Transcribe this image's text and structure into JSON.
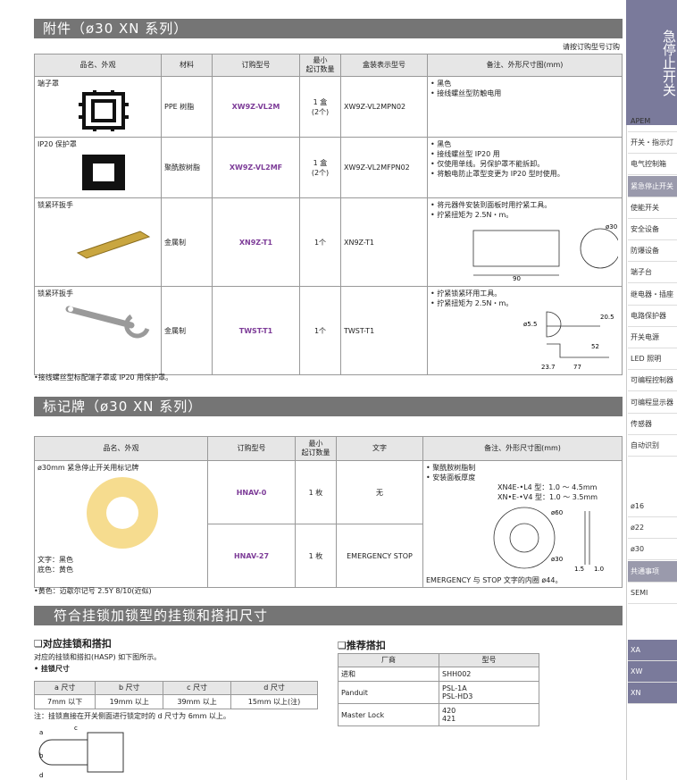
{
  "section1": {
    "title": "附件（ø30 XN 系列）",
    "note_right": "请按订购型号订购",
    "headers": [
      "品名、外观",
      "材料",
      "订购型号",
      "最小\n起订数量",
      "盒装表示型号",
      "备注、外形尺寸图(mm)"
    ],
    "rows": [
      {
        "name": "端子罩",
        "material": "PPE 树脂",
        "model": "XW9Z-VL2M",
        "qty": "1 盒\n(2个)",
        "box": "XW9Z-VL2MPN02",
        "remarks": [
          "黑色",
          "接线螺丝型防触电用"
        ]
      },
      {
        "name": "IP20 保护罩",
        "material": "聚酰胺树脂",
        "model": "XW9Z-VL2MF",
        "qty": "1 盒\n(2个)",
        "box": "XW9Z-VL2MFPN02",
        "remarks": [
          "黑色",
          "接线螺丝型 IP20 用",
          "仅使用单线。另保护罩不能拆卸。",
          "将触电防止罩型变更为 IP20 型时使用。"
        ]
      },
      {
        "name": "锁紧环扳手",
        "material": "金属制",
        "model": "XN9Z-T1",
        "qty": "1个",
        "box": "XN9Z-T1",
        "remarks": [
          "将元器件安装到面板时用拧紧工具。",
          "拧紧扭矩为 2.5N・m。"
        ],
        "dims": [
          "90",
          "ø30"
        ]
      },
      {
        "name": "锁紧环扳手",
        "material": "金属制",
        "model": "TWST-T1",
        "qty": "1个",
        "box": "TWST-T1",
        "remarks": [
          "拧紧锁紧环用工具。",
          "拧紧扭矩为 2.5N・m。"
        ],
        "dims": [
          "ø5.5",
          "20.5",
          "52",
          "23.7",
          "77"
        ]
      }
    ],
    "footnote": "•接线螺丝型标配端子罩或 IP20 用保护罩。"
  },
  "section2": {
    "title": "标记牌（ø30 XN 系列）",
    "headers": [
      "品名、外观",
      "订购型号",
      "最小\n起订数量",
      "文字",
      "备注、外形尺寸图(mm)"
    ],
    "name": "ø30mm 紧急停止开关用标记牌",
    "text_color": "文字：黑色",
    "bg_color": "底色：黄色",
    "rows": [
      {
        "model": "HNAV-0",
        "qty": "1 枚",
        "text": "无"
      },
      {
        "model": "HNAV-27",
        "qty": "1 枚",
        "text": "EMERGENCY  STOP"
      }
    ],
    "remarks": [
      "聚酰胺树脂制",
      "安装面板厚度"
    ],
    "thick1": "XN4E-•L4 型：1.0 ～ 4.5mm",
    "thick2": "XN•E-•V4 型：1.0 ～ 3.5mm",
    "dims": [
      "ø60",
      "ø30",
      "1.5",
      "1.0"
    ],
    "inner": "EMERGENCY 与 STOP 文字的内圈 ø44。",
    "footnote": "•黄色：迈歇尔记号 2.5Y 8/10(近似)"
  },
  "section3": {
    "title": "符合挂锁加锁型的挂锁和搭扣尺寸",
    "left_title": "❏对应挂锁和搭扣",
    "left_desc": "对应的挂锁和搭扣(HASP) 如下图所示。",
    "lock_title": "• 挂锁尺寸",
    "lock_headers": [
      "a 尺寸",
      "b 尺寸",
      "c 尺寸",
      "d 尺寸"
    ],
    "lock_values": [
      "7mm 以下",
      "19mm 以上",
      "39mm 以上",
      "15mm 以上(注)"
    ],
    "lock_note": "注：挂锁直接在开关侧面进行锁定时的 d 尺寸为 6mm 以上。",
    "fig_labels": [
      "a",
      "c",
      "b",
      "d"
    ],
    "right_title": "❏推荐搭扣",
    "hasp_headers": [
      "厂商",
      "型号"
    ],
    "hasp_rows": [
      {
        "maker": "进和",
        "models": "SHH002"
      },
      {
        "maker": "Panduit",
        "models": "PSL-1A\nPSL-HD3"
      },
      {
        "maker": "Master Lock",
        "models": "420\n421"
      }
    ]
  },
  "sidebar": {
    "top": "急停止开关",
    "items": [
      "APEM",
      "开关・指示灯",
      "电气控制箱",
      "紧急停止开关",
      "使能开关",
      "安全设备",
      "防爆设备",
      "端子台",
      "继电器・插座",
      "电路保护器",
      "开关电源",
      "LED 照明",
      "可编程控制器",
      "可编程显示器",
      "传感器",
      "自动识别"
    ],
    "sizes": [
      "ø16",
      "ø22",
      "ø30",
      "共通事项",
      "SEMI"
    ],
    "series": [
      "XA",
      "XW",
      "XN"
    ]
  },
  "colors": {
    "accent": "#7d3c98",
    "bar": "#757575",
    "side": "#7a7a9b"
  }
}
